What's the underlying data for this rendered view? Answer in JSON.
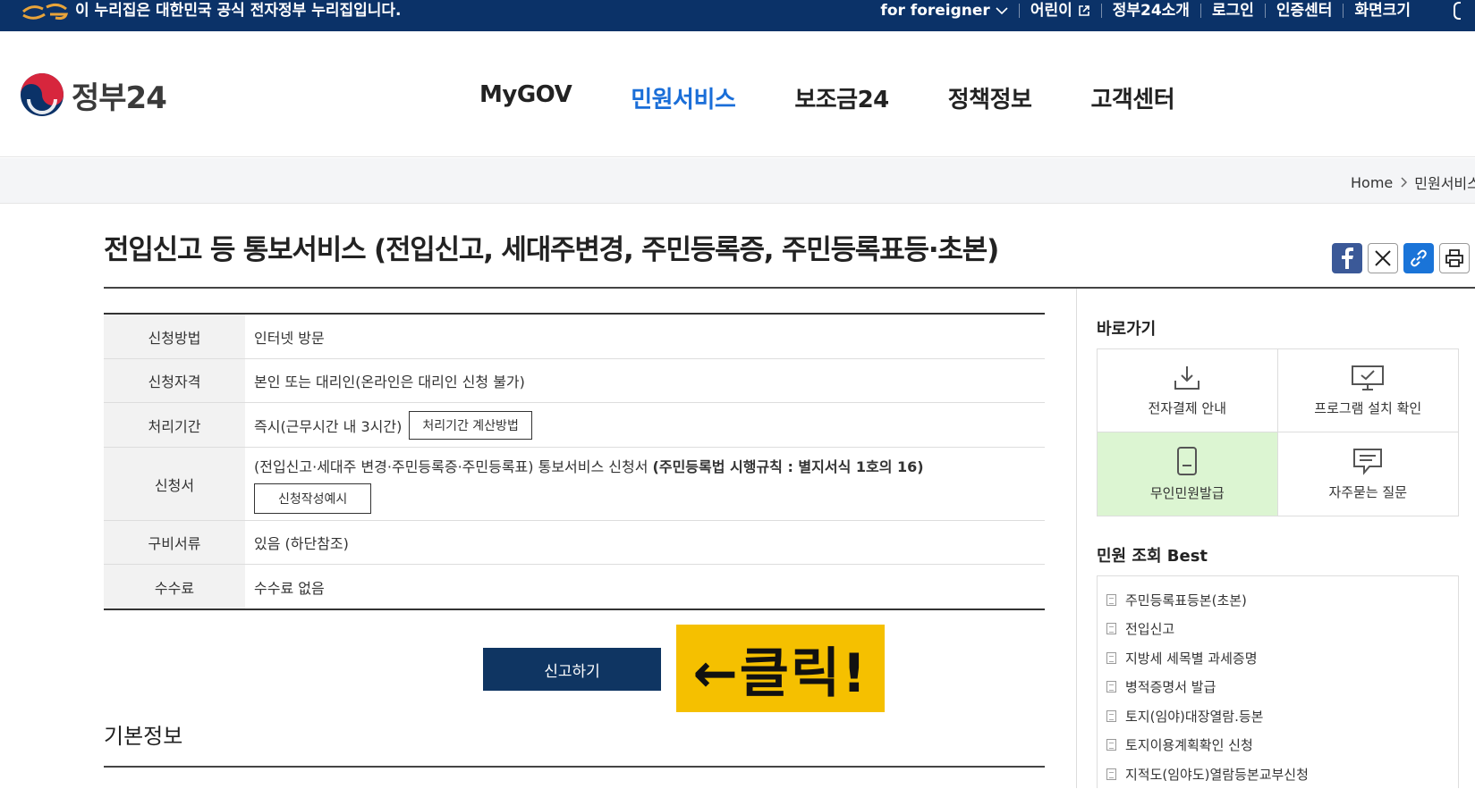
{
  "govbar": {
    "notice": "이 누리집은 대한민국 공식 전자정부 누리집입니다.",
    "utils": [
      "for foreigner",
      "어린이",
      "정부24소개",
      "로그인",
      "인증센터",
      "화면크기"
    ]
  },
  "header": {
    "logo_text": "정부24",
    "nav": [
      "MyGOV",
      "민원서비스",
      "보조금24",
      "정책정보",
      "고객센터"
    ],
    "active_nav": "민원서비스"
  },
  "breadcrumb": [
    "Home",
    "민원서비스"
  ],
  "page": {
    "title": "전입신고 등 통보서비스 (전입신고, 세대주변경, 주민등록증, 주민등록표등·초본)"
  },
  "info_table": {
    "rows": [
      {
        "label": "신청방법",
        "value": "인터넷 방문"
      },
      {
        "label": "신청자격",
        "value": "본인 또는 대리인(온라인은 대리인 신청 불가)"
      },
      {
        "label": "처리기간",
        "value": "즉시(근무시간 내 3시간)",
        "button": "처리기간 계산방법"
      },
      {
        "label": "신청서",
        "value": "(전입신고·세대주 변경·주민등록증·주민등록표) 통보서비스 신청서 ",
        "value_bold": "(주민등록법 시행규칙 : 별지서식 1호의 16)",
        "button": "신청작성예시"
      },
      {
        "label": "구비서류",
        "value": "있음 (하단참조)"
      },
      {
        "label": "수수료",
        "value": "수수료 없음"
      }
    ]
  },
  "apply_button": "신고하기",
  "callout": "←클릭!",
  "section_basic": "기본정보",
  "quick_links": {
    "title": "바로가기",
    "items": [
      {
        "label": "전자결제 안내",
        "icon": "download-icon"
      },
      {
        "label": "프로그램 설치 확인",
        "icon": "monitor-check-icon"
      },
      {
        "label": "무인민원발급",
        "icon": "kiosk-icon"
      },
      {
        "label": "자주묻는 질문",
        "icon": "chat-icon"
      }
    ]
  },
  "best": {
    "title": "민원 조회 Best",
    "items": [
      "주민등록표등본(초본)",
      "전입신고",
      "지방세 세목별 과세증명",
      "병적증명서 발급",
      "토지(임야)대장열람.등본",
      "토지이용계획확인 신청",
      "지적도(임야도)열람등본교부신청"
    ]
  },
  "colors": {
    "govbar": "#0b3268",
    "active_nav": "#1a6ed8",
    "apply_button": "#0f3562",
    "callout": "#f5c000",
    "highlight_cell": "#dcf5d2"
  }
}
